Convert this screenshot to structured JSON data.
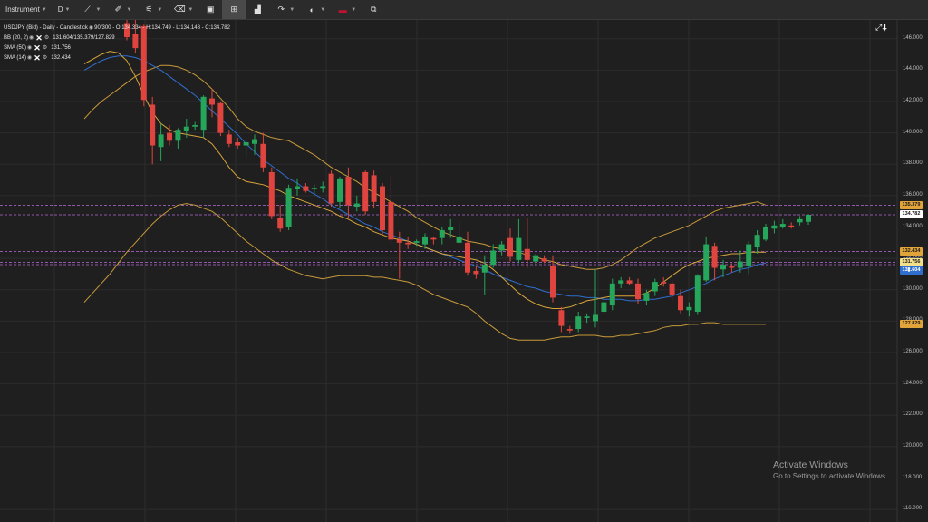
{
  "toolbar": {
    "instrument_label": "Instrument",
    "timeframe_label": "D",
    "items": [
      {
        "name": "draw-line-icon",
        "glyph": "✎"
      },
      {
        "name": "pencil-icon",
        "glyph": "✐"
      },
      {
        "name": "indicators-icon",
        "glyph": "⚟"
      },
      {
        "name": "trash-icon",
        "glyph": "🗑"
      },
      {
        "name": "layout-icon",
        "glyph": "▣"
      },
      {
        "name": "multi-chart-icon",
        "glyph": "⊞"
      },
      {
        "name": "bar-chart-icon",
        "glyph": "▟"
      },
      {
        "name": "share-icon",
        "glyph": "↷"
      },
      {
        "name": "theme-icon",
        "glyph": "◐"
      },
      {
        "name": "language-flag-icon",
        "glyph": "▬"
      },
      {
        "name": "popout-icon",
        "glyph": "⧉"
      }
    ]
  },
  "legend": {
    "title": "USDJPY (Bid) - Daily - Candlestick",
    "ohlc": "90/300 - O:134.334 - H:134.749 - L:134.148 - C:134.782",
    "indicators": [
      {
        "name": "BB (20, 2)",
        "values": "131.604/135.379/127.829"
      },
      {
        "name": "SMA (50)",
        "values": "131.756"
      },
      {
        "name": "SMA (14)",
        "values": "132.434"
      }
    ]
  },
  "price_tags": [
    {
      "label": "135.379",
      "price": 135.379,
      "bg": "#e0a43a",
      "fg": "#1a1a1a"
    },
    {
      "label": "134.782",
      "price": 134.782,
      "bg": "#ffffff",
      "fg": "#1a1a1a"
    },
    {
      "label": "132.434",
      "price": 132.434,
      "bg": "#e0a43a",
      "fg": "#1a1a1a"
    },
    {
      "label": "131.756",
      "price": 131.756,
      "bg": "#f5e08a",
      "fg": "#1a1a1a"
    },
    {
      "label": "131.604",
      "price": 131.604,
      "bg": "#2f6fd0",
      "fg": "#ffffff"
    },
    {
      "label": "127.829",
      "price": 127.829,
      "bg": "#e0a43a",
      "fg": "#1a1a1a"
    }
  ],
  "watermark": {
    "line1": "Activate Windows",
    "line2": "Go to Settings to activate Windows."
  },
  "colors": {
    "up": "#26a65b",
    "down": "#e0443e",
    "bb": "#c79a3a",
    "sma50": "#2f6fd0",
    "sma14": "#d9a53a",
    "hline": "#b96bd9",
    "grid": "#2c2c2c"
  },
  "chart_data": {
    "type": "candlestick",
    "yaxis_labels": [
      "146.000",
      "144.000",
      "142.000",
      "140.000",
      "138.000",
      "136.000",
      "134.000",
      "132.000",
      "130.000",
      "128.000",
      "126.000",
      "124.000",
      "122.000",
      "120.000",
      "118.000",
      "116.000"
    ],
    "ylim": [
      115.2,
      147.2
    ],
    "candles": [
      {
        "o": 147.0,
        "h": 147.4,
        "l": 145.9,
        "c": 146.1
      },
      {
        "o": 146.3,
        "h": 147.2,
        "l": 145.1,
        "c": 145.4
      },
      {
        "o": 146.8,
        "h": 146.9,
        "l": 141.7,
        "c": 142.1
      },
      {
        "o": 141.8,
        "h": 142.3,
        "l": 138.0,
        "c": 139.2
      },
      {
        "o": 139.1,
        "h": 140.6,
        "l": 138.2,
        "c": 139.9
      },
      {
        "o": 140.0,
        "h": 140.5,
        "l": 139.2,
        "c": 139.5
      },
      {
        "o": 139.5,
        "h": 140.3,
        "l": 139.0,
        "c": 140.2
      },
      {
        "o": 140.1,
        "h": 140.9,
        "l": 139.7,
        "c": 140.4
      },
      {
        "o": 140.4,
        "h": 140.7,
        "l": 140.2,
        "c": 140.5
      },
      {
        "o": 140.2,
        "h": 142.4,
        "l": 139.7,
        "c": 142.3
      },
      {
        "o": 142.2,
        "h": 142.8,
        "l": 141.0,
        "c": 141.8
      },
      {
        "o": 141.9,
        "h": 142.0,
        "l": 139.8,
        "c": 140.0
      },
      {
        "o": 139.9,
        "h": 140.2,
        "l": 139.1,
        "c": 139.3
      },
      {
        "o": 139.4,
        "h": 139.7,
        "l": 139.0,
        "c": 139.2
      },
      {
        "o": 139.2,
        "h": 139.6,
        "l": 138.5,
        "c": 139.4
      },
      {
        "o": 139.3,
        "h": 139.9,
        "l": 138.6,
        "c": 139.6
      },
      {
        "o": 139.3,
        "h": 140.0,
        "l": 137.5,
        "c": 137.8
      },
      {
        "o": 137.5,
        "h": 137.8,
        "l": 134.5,
        "c": 134.7
      },
      {
        "o": 134.6,
        "h": 135.4,
        "l": 133.7,
        "c": 133.9
      },
      {
        "o": 134.0,
        "h": 136.7,
        "l": 133.8,
        "c": 136.5
      },
      {
        "o": 136.4,
        "h": 137.1,
        "l": 136.0,
        "c": 136.6
      },
      {
        "o": 136.6,
        "h": 136.8,
        "l": 136.2,
        "c": 136.3
      },
      {
        "o": 136.4,
        "h": 136.7,
        "l": 136.1,
        "c": 136.5
      },
      {
        "o": 136.5,
        "h": 136.9,
        "l": 136.2,
        "c": 136.6
      },
      {
        "o": 137.4,
        "h": 137.6,
        "l": 135.3,
        "c": 135.5
      },
      {
        "o": 135.6,
        "h": 137.2,
        "l": 135.2,
        "c": 137.1
      },
      {
        "o": 137.2,
        "h": 137.8,
        "l": 134.6,
        "c": 135.4
      },
      {
        "o": 135.3,
        "h": 136.0,
        "l": 135.0,
        "c": 135.5
      },
      {
        "o": 137.5,
        "h": 137.6,
        "l": 134.8,
        "c": 135.0
      },
      {
        "o": 137.3,
        "h": 137.6,
        "l": 135.2,
        "c": 135.6
      },
      {
        "o": 136.6,
        "h": 136.8,
        "l": 133.5,
        "c": 133.8
      },
      {
        "o": 135.6,
        "h": 137.3,
        "l": 133.0,
        "c": 133.2
      },
      {
        "o": 133.2,
        "h": 133.7,
        "l": 130.7,
        "c": 133.0
      },
      {
        "o": 133.0,
        "h": 133.4,
        "l": 132.6,
        "c": 132.9
      },
      {
        "o": 133.0,
        "h": 133.2,
        "l": 132.8,
        "c": 133.1
      },
      {
        "o": 132.9,
        "h": 133.6,
        "l": 132.6,
        "c": 133.4
      },
      {
        "o": 133.3,
        "h": 133.4,
        "l": 132.9,
        "c": 133.2
      },
      {
        "o": 133.3,
        "h": 134.0,
        "l": 132.9,
        "c": 133.8
      },
      {
        "o": 133.8,
        "h": 134.5,
        "l": 133.3,
        "c": 134.0
      },
      {
        "o": 133.0,
        "h": 134.3,
        "l": 132.9,
        "c": 133.4
      },
      {
        "o": 133.0,
        "h": 133.7,
        "l": 130.9,
        "c": 131.1
      },
      {
        "o": 131.2,
        "h": 131.5,
        "l": 130.7,
        "c": 131.0
      },
      {
        "o": 131.1,
        "h": 132.2,
        "l": 129.7,
        "c": 131.6
      },
      {
        "o": 131.6,
        "h": 132.9,
        "l": 131.4,
        "c": 132.5
      },
      {
        "o": 132.5,
        "h": 133.1,
        "l": 132.2,
        "c": 132.9
      },
      {
        "o": 133.3,
        "h": 133.9,
        "l": 131.8,
        "c": 132.1
      },
      {
        "o": 131.9,
        "h": 134.5,
        "l": 131.7,
        "c": 133.3
      },
      {
        "o": 132.6,
        "h": 134.6,
        "l": 131.4,
        "c": 131.9
      },
      {
        "o": 131.8,
        "h": 132.3,
        "l": 131.5,
        "c": 132.2
      },
      {
        "o": 132.0,
        "h": 132.2,
        "l": 131.7,
        "c": 131.8
      },
      {
        "o": 131.5,
        "h": 132.2,
        "l": 129.2,
        "c": 129.5
      },
      {
        "o": 128.7,
        "h": 128.9,
        "l": 127.3,
        "c": 127.7
      },
      {
        "o": 127.5,
        "h": 127.7,
        "l": 127.2,
        "c": 127.4
      },
      {
        "o": 127.5,
        "h": 128.6,
        "l": 127.3,
        "c": 128.3
      },
      {
        "o": 128.2,
        "h": 128.5,
        "l": 127.9,
        "c": 128.3
      },
      {
        "o": 128.0,
        "h": 131.3,
        "l": 127.6,
        "c": 128.4
      },
      {
        "o": 128.6,
        "h": 129.5,
        "l": 128.4,
        "c": 129.2
      },
      {
        "o": 129.0,
        "h": 130.7,
        "l": 128.7,
        "c": 130.4
      },
      {
        "o": 130.4,
        "h": 130.8,
        "l": 130.1,
        "c": 130.6
      },
      {
        "o": 130.6,
        "h": 130.8,
        "l": 130.3,
        "c": 130.4
      },
      {
        "o": 130.4,
        "h": 130.7,
        "l": 129.1,
        "c": 129.4
      },
      {
        "o": 129.3,
        "h": 130.0,
        "l": 129.0,
        "c": 129.8
      },
      {
        "o": 129.9,
        "h": 130.7,
        "l": 129.6,
        "c": 130.5
      },
      {
        "o": 130.5,
        "h": 130.8,
        "l": 130.2,
        "c": 130.4
      },
      {
        "o": 130.4,
        "h": 130.6,
        "l": 129.3,
        "c": 129.7
      },
      {
        "o": 129.6,
        "h": 130.0,
        "l": 128.5,
        "c": 128.7
      },
      {
        "o": 128.7,
        "h": 129.2,
        "l": 128.3,
        "c": 128.9
      },
      {
        "o": 128.6,
        "h": 131.0,
        "l": 128.4,
        "c": 130.9
      },
      {
        "o": 130.6,
        "h": 133.4,
        "l": 130.5,
        "c": 132.9
      },
      {
        "o": 132.8,
        "h": 133.0,
        "l": 130.6,
        "c": 131.4
      },
      {
        "o": 131.3,
        "h": 131.9,
        "l": 130.8,
        "c": 131.6
      },
      {
        "o": 131.5,
        "h": 131.7,
        "l": 131.1,
        "c": 131.4
      },
      {
        "o": 131.4,
        "h": 132.5,
        "l": 131.1,
        "c": 131.8
      },
      {
        "o": 131.5,
        "h": 133.1,
        "l": 131.0,
        "c": 132.9
      },
      {
        "o": 132.7,
        "h": 133.8,
        "l": 132.3,
        "c": 133.5
      },
      {
        "o": 133.2,
        "h": 134.2,
        "l": 133.1,
        "c": 134.0
      },
      {
        "o": 133.9,
        "h": 134.4,
        "l": 133.6,
        "c": 134.1
      },
      {
        "o": 134.0,
        "h": 134.5,
        "l": 133.9,
        "c": 134.2
      },
      {
        "o": 134.1,
        "h": 134.3,
        "l": 133.9,
        "c": 134.0
      },
      {
        "o": 134.3,
        "h": 134.7,
        "l": 134.1,
        "c": 134.5
      },
      {
        "o": 134.334,
        "h": 134.749,
        "l": 134.148,
        "c": 134.782
      }
    ],
    "series": [
      {
        "name": "BB (20, 2)",
        "values": [
          140.9,
          141.5,
          142.0,
          142.4,
          142.8,
          143.2,
          143.6,
          143.9,
          144.1,
          144.3,
          144.3,
          144.2,
          144.0,
          143.7,
          143.3,
          142.8,
          142.2,
          141.6,
          140.9,
          140.4,
          140.1,
          139.9,
          139.7,
          139.6,
          139.5,
          139.2,
          138.9,
          138.6,
          138.2,
          137.8,
          137.5,
          137.2,
          136.9,
          136.5,
          136.2,
          135.9,
          135.6,
          135.3,
          135.0,
          134.6,
          134.3,
          134.0,
          133.7,
          133.5,
          133.3,
          133.1,
          133.0,
          132.9,
          132.7,
          132.6,
          132.5,
          132.4,
          132.2,
          132.1,
          131.9,
          131.8,
          131.6,
          131.5,
          131.4,
          131.3,
          131.3,
          131.4,
          131.6,
          131.9,
          132.3,
          132.7,
          133.0,
          133.3,
          133.5,
          133.7,
          133.9,
          134.1,
          134.4,
          134.7,
          135.0,
          135.2,
          135.3,
          135.4,
          135.5,
          135.6,
          135.4
        ]
      },
      {
        "name": "BB (20, 2)",
        "values": [
          129.2,
          129.8,
          130.4,
          131.0,
          131.7,
          132.4,
          133.0,
          133.6,
          134.2,
          134.7,
          135.1,
          135.4,
          135.5,
          135.4,
          135.2,
          135.0,
          134.6,
          134.1,
          133.6,
          133.1,
          132.7,
          132.3,
          131.9,
          131.6,
          131.3,
          131.1,
          130.9,
          130.8,
          130.7,
          130.8,
          130.9,
          130.9,
          130.9,
          130.9,
          130.8,
          130.8,
          130.7,
          130.6,
          130.5,
          130.3,
          130.0,
          129.7,
          129.5,
          129.3,
          129.1,
          128.9,
          128.5,
          128.0,
          127.6,
          127.2,
          126.9,
          126.8,
          126.8,
          126.8,
          126.8,
          126.9,
          127.0,
          127.0,
          127.1,
          127.1,
          127.1,
          127.0,
          127.0,
          127.1,
          127.1,
          127.2,
          127.3,
          127.4,
          127.6,
          127.7,
          127.7,
          127.8,
          127.8,
          127.9,
          127.9,
          127.8,
          127.8,
          127.8,
          127.8,
          127.8,
          127.8
        ]
      },
      {
        "name": "SMA (50)",
        "values": [
          144.0,
          144.3,
          144.6,
          144.8,
          144.9,
          144.9,
          144.8,
          144.6,
          144.3,
          144.0,
          143.6,
          143.2,
          142.8,
          142.4,
          141.9,
          141.4,
          140.9,
          140.4,
          139.9,
          139.3,
          138.8,
          138.3,
          137.9,
          137.5,
          137.1,
          136.8,
          136.4,
          136.1,
          135.8,
          135.4,
          135.1,
          134.8,
          134.5,
          134.2,
          134.0,
          133.7,
          133.5,
          133.3,
          133.1,
          132.9,
          132.7,
          132.5,
          132.3,
          132.1,
          131.9,
          131.7,
          131.5,
          131.3,
          131.0,
          130.8,
          130.6,
          130.4,
          130.2,
          130.1,
          129.9,
          129.8,
          129.7,
          129.6,
          129.6,
          129.5,
          129.5,
          129.4,
          129.4,
          129.4,
          129.3,
          129.3,
          129.4,
          129.4,
          129.5,
          129.6,
          129.8,
          130.0,
          130.2,
          130.4,
          130.7,
          130.9,
          131.1,
          131.3,
          131.4,
          131.6,
          131.7
        ]
      },
      {
        "name": "SMA (14)",
        "values": [
          144.4,
          144.7,
          145.0,
          145.2,
          145.1,
          144.6,
          143.6,
          142.4,
          141.3,
          140.6,
          140.2,
          140.0,
          139.9,
          139.8,
          139.7,
          139.3,
          138.6,
          137.8,
          137.2,
          136.9,
          136.8,
          136.7,
          136.5,
          136.3,
          136.0,
          135.8,
          135.6,
          135.4,
          135.2,
          135.0,
          134.7,
          134.5,
          134.2,
          134.0,
          133.7,
          133.5,
          133.3,
          133.2,
          133.1,
          132.9,
          132.7,
          132.5,
          132.3,
          132.2,
          132.1,
          132.0,
          131.9,
          131.7,
          131.3,
          130.8,
          130.3,
          129.8,
          129.4,
          129.1,
          128.9,
          128.8,
          128.8,
          128.9,
          129.1,
          129.3,
          129.4,
          129.5,
          129.6,
          129.6,
          129.6,
          129.6,
          129.8,
          130.1,
          130.5,
          130.9,
          131.3,
          131.6,
          131.8,
          132.0,
          132.1,
          132.2,
          132.3,
          132.3,
          132.4,
          132.4,
          132.4
        ]
      }
    ],
    "hlines": [
      135.379,
      134.782,
      132.434,
      131.756,
      131.604,
      127.829
    ]
  }
}
